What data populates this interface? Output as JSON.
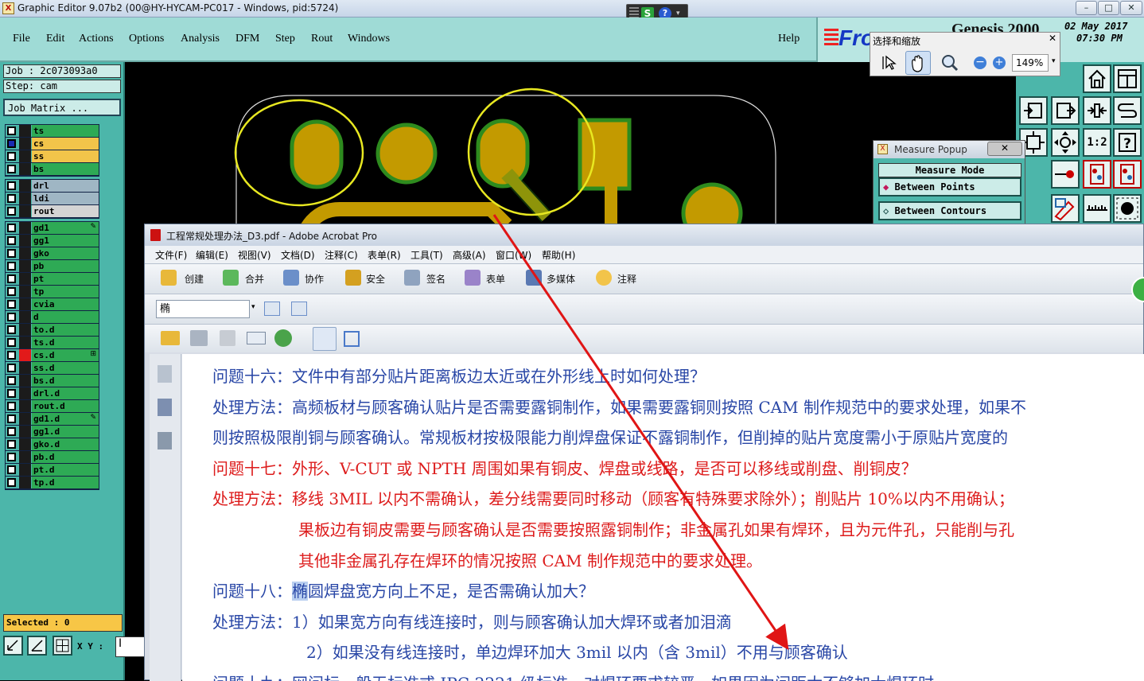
{
  "genesis": {
    "title": "Graphic Editor 9.07b2 (00@HY-HYCAM-PC017 - Windows, pid:5724)",
    "menu": [
      "File",
      "Edit",
      "Actions",
      "Options",
      "Analysis",
      "DFM",
      "Step",
      "Rout",
      "Windows"
    ],
    "help": "Help",
    "brand": "Genesis 2000",
    "logo_text": "Fro",
    "date": "02 May 2017",
    "time": "07:30 PM",
    "job": "Job : 2c073093a0",
    "step": "Step: cam",
    "job_matrix": "Job Matrix ...",
    "selected": "Selected : 0",
    "xy_label": "X Y :",
    "xy_value": "I",
    "layer_groups": [
      [
        {
          "name": "ts",
          "color": "#2eaa55",
          "sw": "#1b1b1b"
        },
        {
          "name": "cs",
          "color": "#f2c44a",
          "sw": "#1b1b1b",
          "checked": true
        },
        {
          "name": "ss",
          "color": "#f2c44a",
          "sw": "#1b1b1b"
        },
        {
          "name": "bs",
          "color": "#2eaa55",
          "sw": "#1b1b1b"
        }
      ],
      [
        {
          "name": "drl",
          "color": "#9fb6c4",
          "sw": "#1b1b1b"
        },
        {
          "name": "ldi",
          "color": "#9fb6c4",
          "sw": "#1b1b1b"
        },
        {
          "name": "rout",
          "color": "#d4d4d4",
          "sw": "#1b1b1b"
        }
      ],
      [
        {
          "name": "gd1",
          "color": "#2eaa55",
          "sw": "#1b1b1b",
          "mark": "pen"
        },
        {
          "name": "gg1",
          "color": "#2eaa55",
          "sw": "#1b1b1b"
        },
        {
          "name": "gko",
          "color": "#2eaa55",
          "sw": "#1b1b1b"
        },
        {
          "name": "pb",
          "color": "#2eaa55",
          "sw": "#1b1b1b"
        },
        {
          "name": "pt",
          "color": "#2eaa55",
          "sw": "#1b1b1b"
        },
        {
          "name": "tp",
          "color": "#2eaa55",
          "sw": "#1b1b1b"
        },
        {
          "name": "cvia",
          "color": "#2eaa55",
          "sw": "#1b1b1b"
        },
        {
          "name": "d",
          "color": "#2eaa55",
          "sw": "#1b1b1b"
        },
        {
          "name": "to.d",
          "color": "#2eaa55",
          "sw": "#1b1b1b"
        },
        {
          "name": "ts.d",
          "color": "#2eaa55",
          "sw": "#1b1b1b"
        },
        {
          "name": "cs.d",
          "color": "#2eaa55",
          "sw": "#e21a1a",
          "mark": "grid"
        },
        {
          "name": "ss.d",
          "color": "#2eaa55",
          "sw": "#1b1b1b"
        },
        {
          "name": "bs.d",
          "color": "#2eaa55",
          "sw": "#1b1b1b"
        },
        {
          "name": "drl.d",
          "color": "#2eaa55",
          "sw": "#1b1b1b"
        },
        {
          "name": "rout.d",
          "color": "#2eaa55",
          "sw": "#1b1b1b"
        },
        {
          "name": "gd1.d",
          "color": "#2eaa55",
          "sw": "#1b1b1b",
          "mark": "pen"
        },
        {
          "name": "gg1.d",
          "color": "#2eaa55",
          "sw": "#1b1b1b"
        },
        {
          "name": "gko.d",
          "color": "#2eaa55",
          "sw": "#1b1b1b"
        },
        {
          "name": "pb.d",
          "color": "#2eaa55",
          "sw": "#1b1b1b"
        },
        {
          "name": "pt.d",
          "color": "#2eaa55",
          "sw": "#1b1b1b"
        },
        {
          "name": "tp.d",
          "color": "#2eaa55",
          "sw": "#1b1b1b"
        }
      ]
    ]
  },
  "zoombar": {
    "title": "选择和缩放",
    "zoom": "149%"
  },
  "measure": {
    "title": "Measure Popup",
    "mode": "Measure Mode",
    "options": [
      "Between Points",
      "Between Contours",
      "Between Nets"
    ]
  },
  "tool_grid": {
    "labels": [
      "1:2"
    ]
  },
  "acrobat": {
    "title": "工程常规处理办法_D3.pdf - Adobe Acrobat Pro",
    "menu": [
      "文件(F)",
      "编辑(E)",
      "视图(V)",
      "文档(D)",
      "注释(C)",
      "表单(R)",
      "工具(T)",
      "高级(A)",
      "窗口(W)",
      "帮助(H)"
    ],
    "toolbar": [
      "创建",
      "合并",
      "协作",
      "安全",
      "签名",
      "表单",
      "多媒体",
      "注释"
    ],
    "search_value": "椭",
    "doc_lines": [
      {
        "text": "问题十六：文件中有部分贴片距离板边太近或在外形线上时如何处理？",
        "color": "blue",
        "indent": 0
      },
      {
        "text": "处理方法：高频板材与顾客确认贴片是否需要露铜制作，如果需要露铜则按照 CAM 制作规范中的要求处理，如果不",
        "color": "blue",
        "indent": 0
      },
      {
        "text": "则按照极限削铜与顾客确认。常规板材按极限能力削焊盘保证不露铜制作，但削掉的贴片宽度需小于原贴片宽度的",
        "color": "blue",
        "indent": 0
      },
      {
        "text": "问题十七：外形、V-CUT 或 NPTH 周围如果有铜皮、焊盘或线路，是否可以移线或削盘、削铜皮？",
        "color": "red",
        "indent": 0
      },
      {
        "text": "处理方法：移线 3MIL 以内不需确认，差分线需要同时移动（顾客有特殊要求除外）；削贴片 10%以内不用确认；",
        "color": "red",
        "indent": 0
      },
      {
        "text": "果板边有铜皮需要与顾客确认是否需要按照露铜制作；非金属孔如果有焊环，且为元件孔，只能削与孔",
        "color": "red",
        "indent": 1
      },
      {
        "text": "其他非金属孔存在焊环的情况按照 CAM 制作规范中的要求处理。",
        "color": "red",
        "indent": 1
      },
      {
        "text": "问题十八：椭圆焊盘宽方向上不足，是否需确认加大？",
        "color": "blue",
        "indent": 0,
        "highlight": "椭"
      },
      {
        "text": "处理方法：1）如果宽方向有线连接时，则与顾客确认加大焊环或者加泪滴",
        "color": "blue",
        "indent": 0
      },
      {
        "text": "2）如果没有线连接时，单边焊环加大 3mil 以内（含 3mil）不用与顾客确认",
        "color": "blue",
        "indent": 2
      },
      {
        "text": "问题十九：网问标一般无标准或 IPC-2221 级标准，对焊环要求较严，如果因为间距太不够加大焊环时",
        "color": "blue",
        "indent": 0
      }
    ]
  },
  "colors": {
    "teal": "#4cb6aa",
    "copper": "#c39a00",
    "outline": "#2e8b1e",
    "circle": "#e8e821",
    "arrow": "#e01515"
  }
}
